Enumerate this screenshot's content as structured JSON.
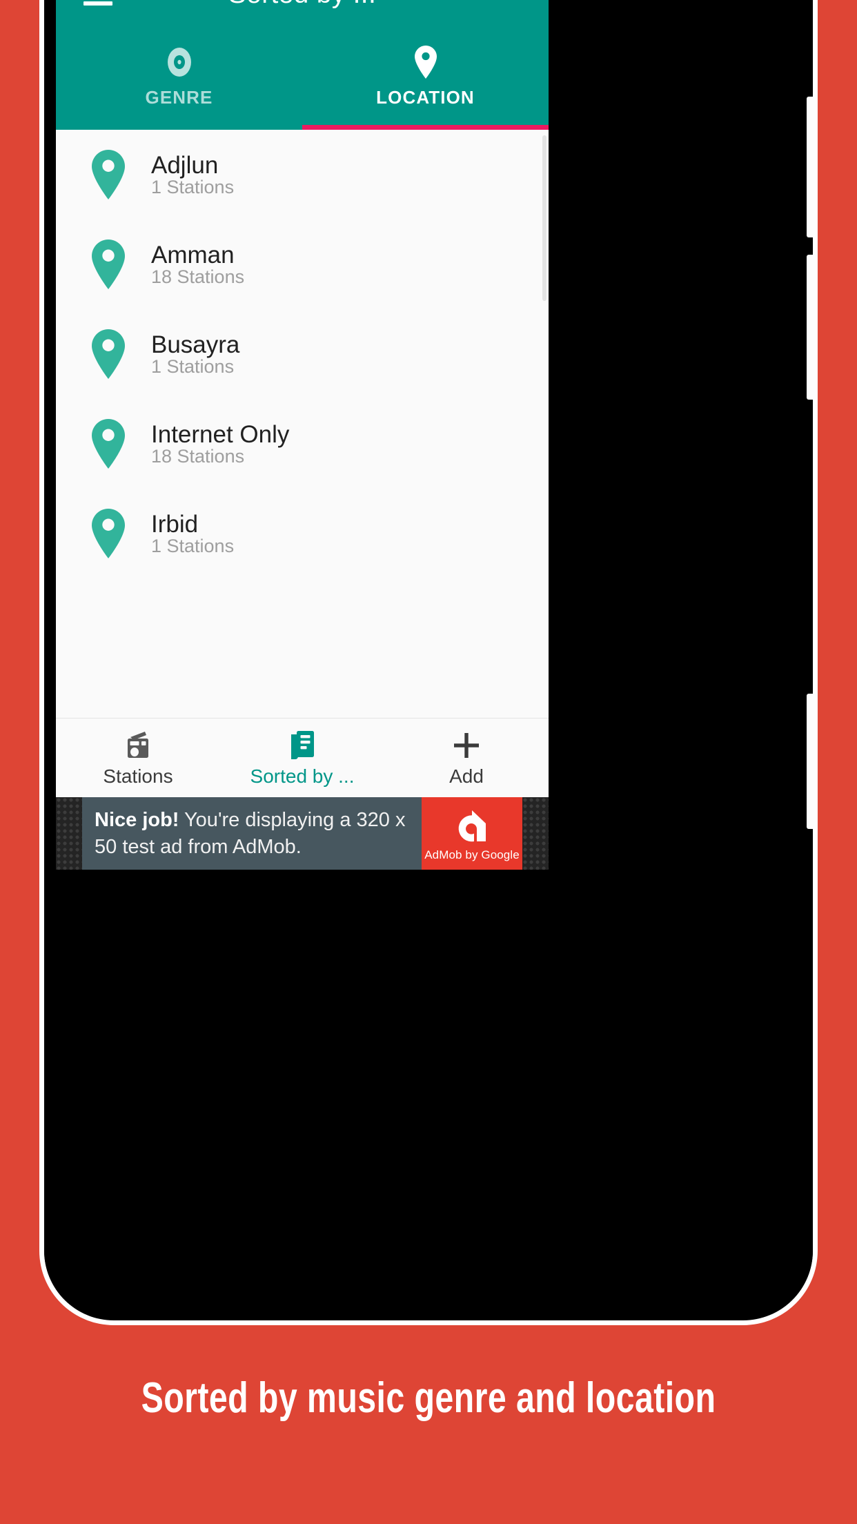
{
  "background": {
    "color": "#DE4535"
  },
  "app": {
    "accent_teal": "#009688",
    "indicator_pink": "#EC1A60",
    "title": "Sorted by ...",
    "menu_icon": "hamburger-menu-icon",
    "tabs": [
      {
        "label": "GENRE",
        "icon": "disc-record-icon",
        "active": false
      },
      {
        "label": "LOCATION",
        "icon": "map-pin-icon",
        "active": true
      }
    ],
    "list": {
      "items": [
        {
          "icon": "map-pin-icon",
          "title": "Adjlun",
          "subtitle": "1 Stations"
        },
        {
          "icon": "map-pin-icon",
          "title": "Amman",
          "subtitle": "18 Stations"
        },
        {
          "icon": "map-pin-icon",
          "title": "Busayra",
          "subtitle": "1 Stations"
        },
        {
          "icon": "map-pin-icon",
          "title": "Internet Only",
          "subtitle": "18 Stations"
        },
        {
          "icon": "map-pin-icon",
          "title": "Irbid",
          "subtitle": "1 Stations"
        }
      ]
    },
    "bottom_nav": [
      {
        "label": "Stations",
        "icon": "radio-icon",
        "active": false
      },
      {
        "label": "Sorted by ...",
        "icon": "list-doc-icon",
        "active": true
      },
      {
        "label": "Add",
        "icon": "plus-icon",
        "active": false
      }
    ]
  },
  "ad": {
    "headline": "Nice job!",
    "body": " You're displaying a 320 x 50 test ad from AdMob.",
    "brand": "AdMob by Google",
    "logo_icon": "admob-logo-icon"
  },
  "caption": {
    "text": "Sorted by music genre and location"
  }
}
